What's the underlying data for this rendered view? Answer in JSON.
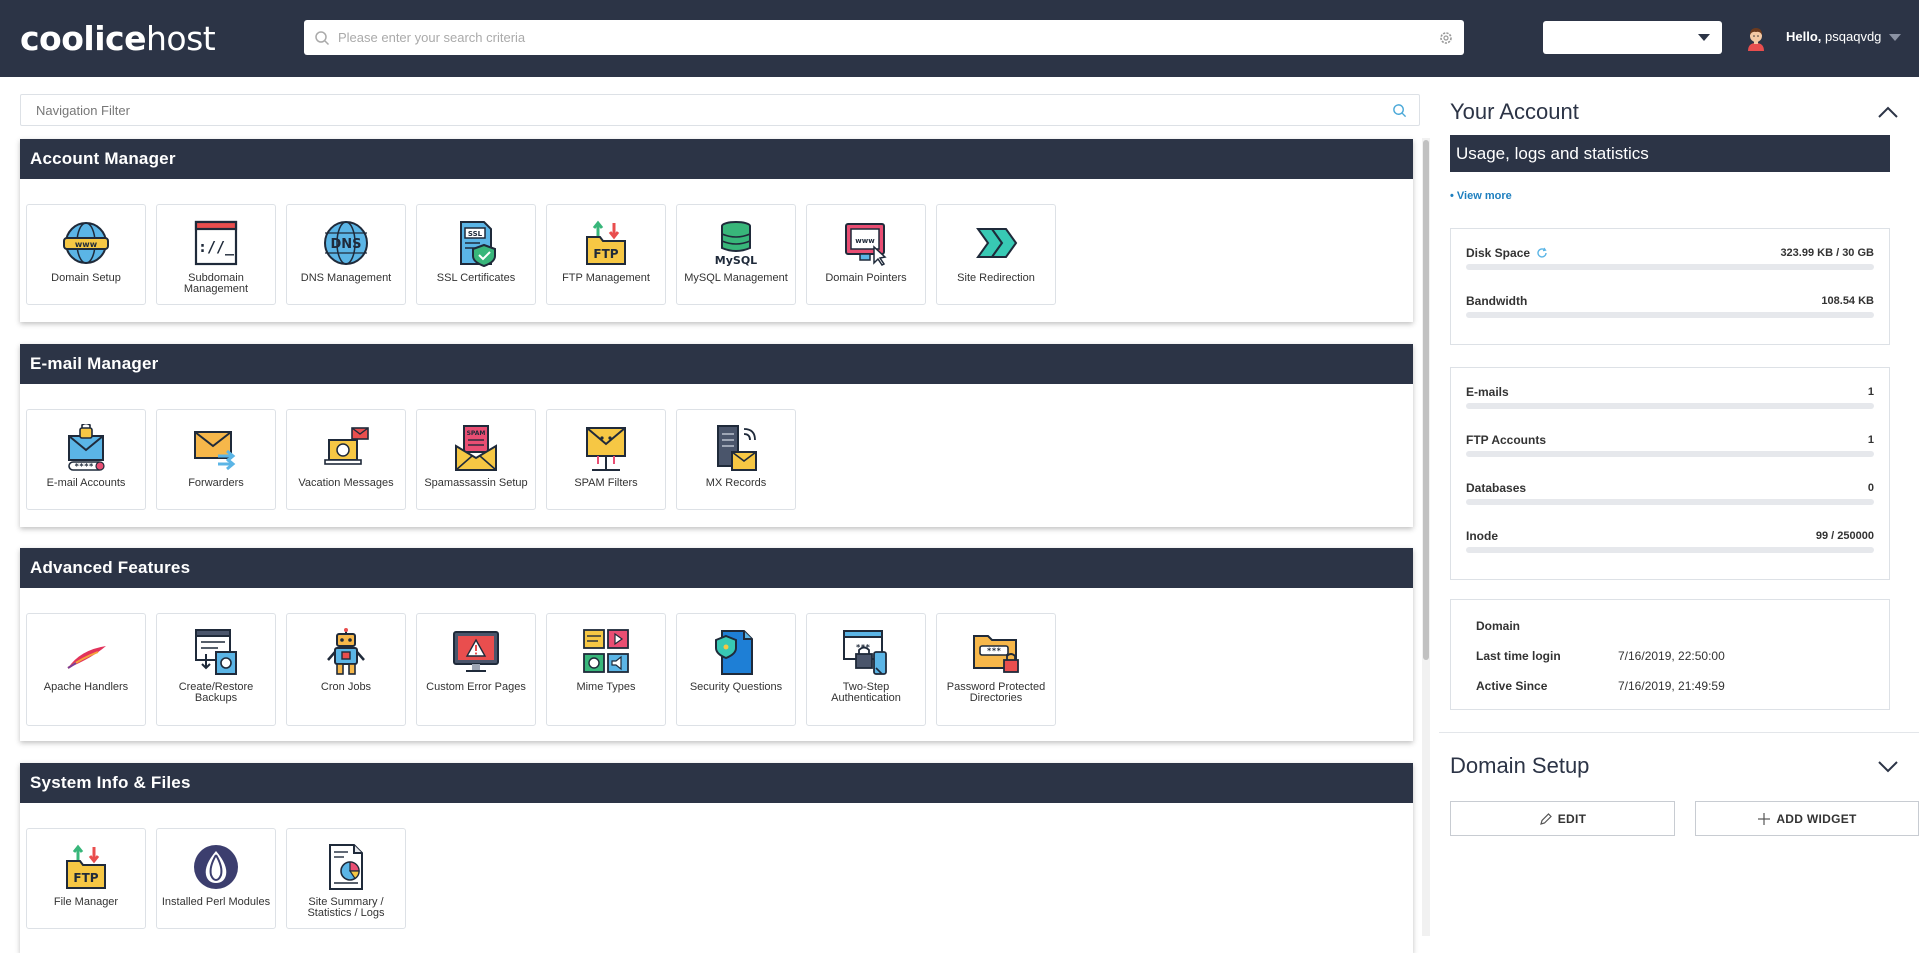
{
  "header": {
    "logo_bold": "coolice",
    "logo_light": "host",
    "search_placeholder": "Please enter your search criteria",
    "greeting": "Hello,",
    "username": "psqaqvdg"
  },
  "nav_filter_placeholder": "Navigation Filter",
  "sections": [
    {
      "title": "Account Manager",
      "items": [
        {
          "label": "Domain Setup",
          "icon": "www-globe-icon"
        },
        {
          "label": "Subdomain Management",
          "icon": "subdomain-window-icon"
        },
        {
          "label": "DNS Management",
          "icon": "dns-globe-icon"
        },
        {
          "label": "SSL Certificates",
          "icon": "ssl-certificate-icon"
        },
        {
          "label": "FTP Management",
          "icon": "ftp-folder-icon"
        },
        {
          "label": "MySQL Management",
          "icon": "mysql-database-icon"
        },
        {
          "label": "Domain Pointers",
          "icon": "domain-pointer-icon"
        },
        {
          "label": "Site Redirection",
          "icon": "redirect-arrows-icon"
        }
      ]
    },
    {
      "title": "E-mail Manager",
      "items": [
        {
          "label": "E-mail Accounts",
          "icon": "email-account-icon"
        },
        {
          "label": "Forwarders",
          "icon": "forward-envelope-icon"
        },
        {
          "label": "Vacation Messages",
          "icon": "vacation-laptop-icon"
        },
        {
          "label": "Spamassassin Setup",
          "icon": "spam-envelope-icon"
        },
        {
          "label": "SPAM Filters",
          "icon": "spam-filter-icon"
        },
        {
          "label": "MX Records",
          "icon": "mx-server-icon"
        }
      ]
    },
    {
      "title": "Advanced Features",
      "items": [
        {
          "label": "Apache Handlers",
          "icon": "apache-feather-icon"
        },
        {
          "label": "Create/Restore Backups",
          "icon": "backup-icon"
        },
        {
          "label": "Cron Jobs",
          "icon": "robot-icon"
        },
        {
          "label": "Custom Error Pages",
          "icon": "error-monitor-icon"
        },
        {
          "label": "Mime Types",
          "icon": "mime-types-icon"
        },
        {
          "label": "Security Questions",
          "icon": "security-document-icon"
        },
        {
          "label": "Two-Step Authentication",
          "icon": "two-step-icon"
        },
        {
          "label": "Password Protected Directories",
          "icon": "password-folder-icon"
        }
      ]
    },
    {
      "title": "System Info & Files",
      "items": [
        {
          "label": "File Manager",
          "icon": "file-manager-icon"
        },
        {
          "label": "Installed Perl Modules",
          "icon": "perl-onion-icon"
        },
        {
          "label": "Site Summary / Statistics / Logs",
          "icon": "statistics-report-icon"
        }
      ]
    }
  ],
  "account": {
    "title": "Your Account",
    "usage_title": "Usage, logs and statistics",
    "view_more": "• View more",
    "disk_space": {
      "label": "Disk Space",
      "value": "323.99 KB / 30 GB",
      "fill": 0.0
    },
    "bandwidth": {
      "label": "Bandwidth",
      "value": "108.54 KB",
      "fill": 0.0
    },
    "emails": {
      "label": "E-mails",
      "value": "1",
      "fill": 0.0
    },
    "ftp_accounts": {
      "label": "FTP Accounts",
      "value": "1",
      "fill": 0.0
    },
    "databases": {
      "label": "Databases",
      "value": "0",
      "fill": 0.0
    },
    "inode": {
      "label": "Inode",
      "value": "99 / 250000",
      "fill": 0.0
    },
    "domain_label": "Domain",
    "last_login_label": "Last time login",
    "last_login_value": "7/16/2019, 22:50:00",
    "active_since_label": "Active Since",
    "active_since_value": "7/16/2019, 21:49:59"
  },
  "domain_setup": {
    "title": "Domain Setup",
    "edit_label": "EDIT",
    "add_widget_label": "ADD WIDGET"
  },
  "colors": {
    "navy": "#2c3446",
    "link": "#1e7fbf"
  }
}
